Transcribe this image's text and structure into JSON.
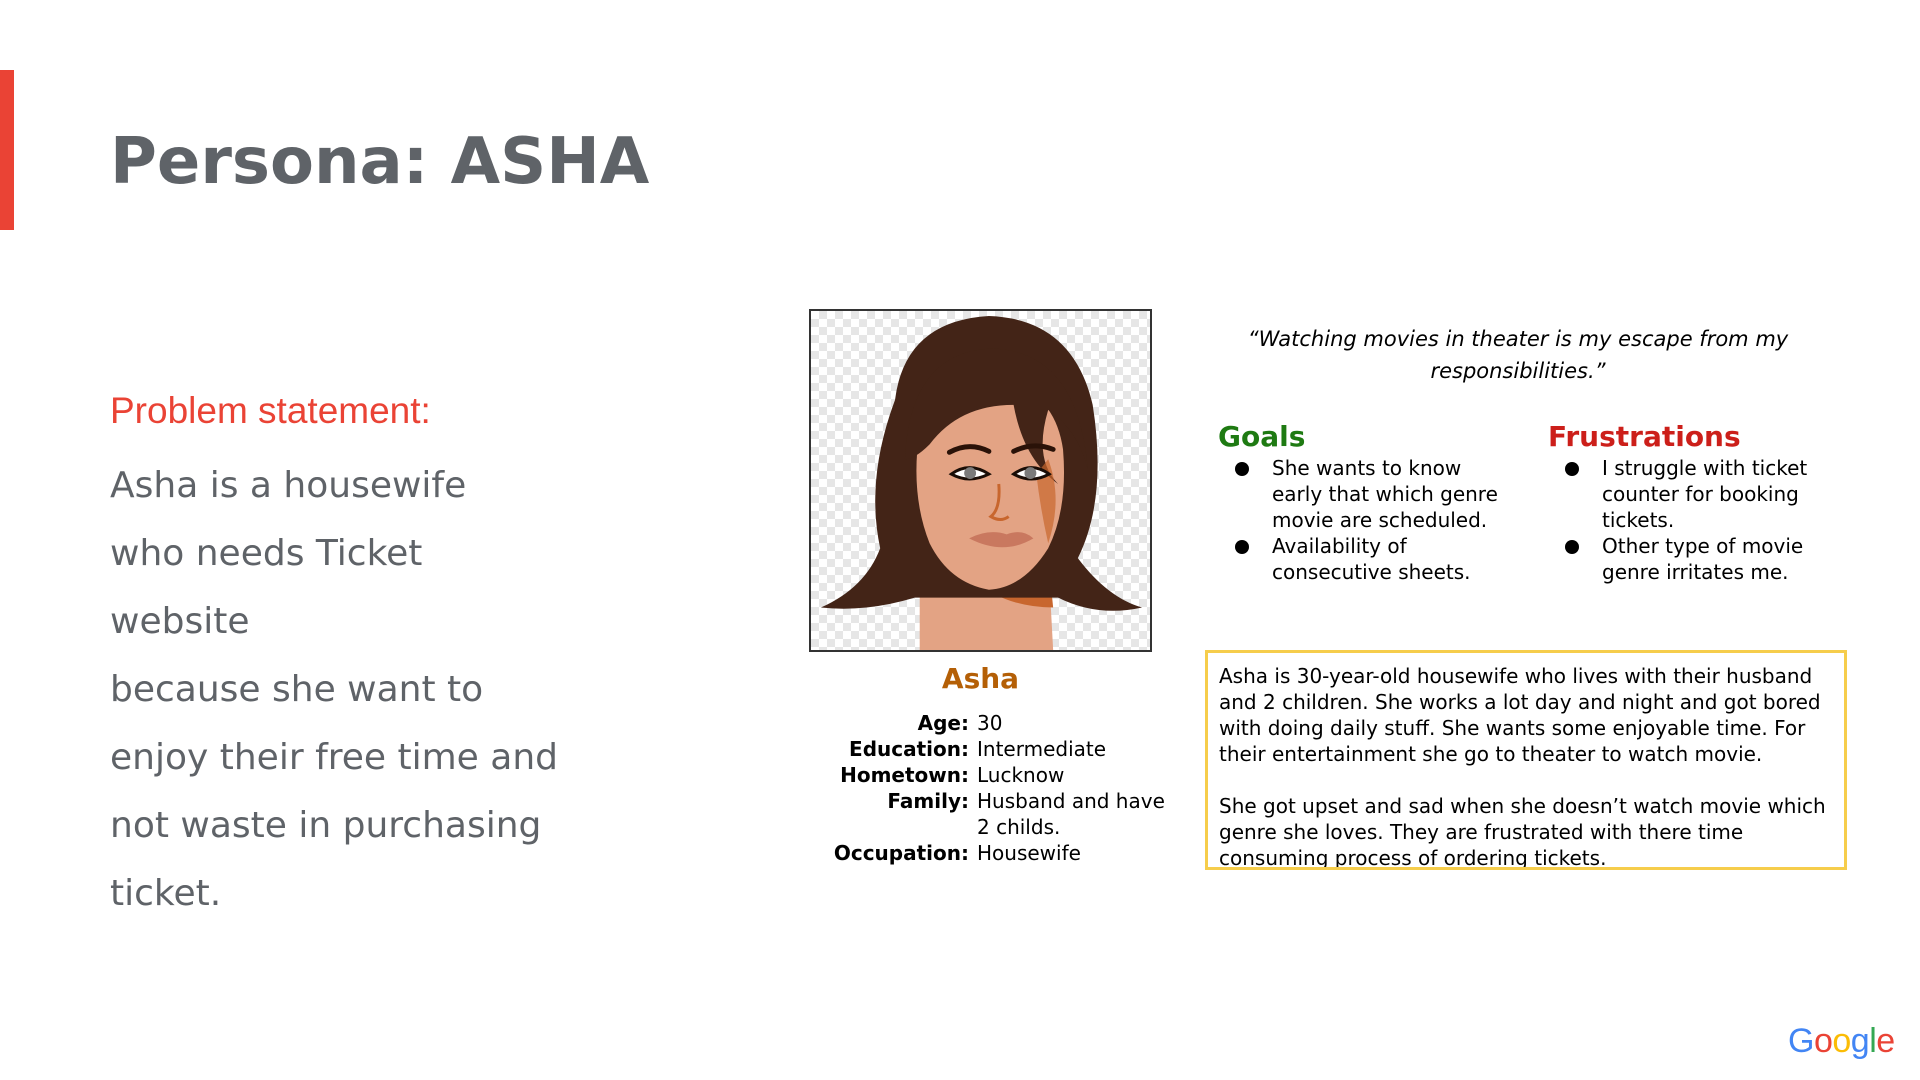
{
  "slide": {
    "title_prefix": "Persona: ",
    "title_name": "ASHA"
  },
  "problem": {
    "heading": "Problem statement:",
    "lines": [
      "Asha is a housewife",
      "who needs Ticket",
      "website",
      "because she want to",
      "enjoy their free time and",
      "not waste in purchasing",
      "ticket."
    ]
  },
  "persona": {
    "name": "Asha",
    "details": [
      {
        "label": "Age:",
        "value": "30"
      },
      {
        "label": "Education:",
        "value": "Intermediate"
      },
      {
        "label": "Hometown:",
        "value": "Lucknow"
      },
      {
        "label": "Family:",
        "value": "Husband and have 2 childs."
      },
      {
        "label": "Occupation:",
        "value": "Housewife"
      }
    ]
  },
  "quote": "“Watching movies in theater is my escape from my responsibilities.”",
  "goals": {
    "heading": "Goals",
    "items": [
      "She wants to know early that which genre movie are scheduled.",
      "Availability of consecutive sheets."
    ]
  },
  "frustrations": {
    "heading": "Frustrations",
    "items": [
      "I struggle with ticket counter for booking tickets.",
      "Other type of movie genre irritates me."
    ]
  },
  "bio": {
    "paragraphs": [
      "Asha is 30-year-old housewife who lives with their husband and 2 children. She works a lot day and night and got bored with doing daily stuff. She wants some enjoyable time. For their entertainment she go to theater to watch movie.",
      "She got upset and sad when she doesn’t watch movie which genre she loves. They are frustrated with there time consuming process of ordering tickets."
    ]
  },
  "logo": {
    "letters": [
      "G",
      "o",
      "o",
      "g",
      "l",
      "e"
    ],
    "colors": [
      "#4285f4",
      "#ea4335",
      "#fbbc05",
      "#4285f4",
      "#34a853",
      "#ea4335"
    ]
  },
  "colors": {
    "accent_bar": "#ea4335",
    "problem_heading": "#ea4335",
    "persona_name": "#b45f06",
    "goals_heading": "#1e7a12",
    "frustrations_heading": "#cc1f1a",
    "bio_border": "#f6cd4b"
  },
  "icons": {
    "portrait": "woman-portrait-illustration",
    "bullet": "filled-circle-bullet"
  }
}
